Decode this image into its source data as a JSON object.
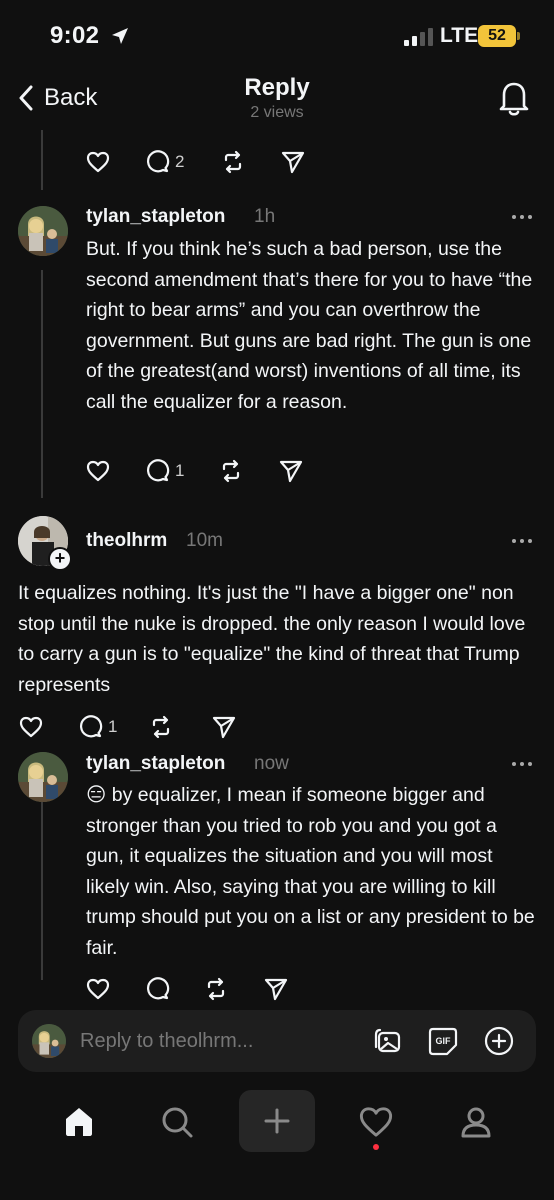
{
  "status_bar": {
    "time": "9:02",
    "network": "LTE",
    "battery": "52"
  },
  "header": {
    "back_label": "Back",
    "title": "Reply",
    "subtitle": "2 views"
  },
  "top_actions": {
    "replies": "2"
  },
  "posts": [
    {
      "username": "tylan_stapleton",
      "time": "1h",
      "text": "But. If you think he’s such a bad person, use the second amendment that’s there for you to have “the right to bear arms” and you can overthrow the government. But guns are bad right. The gun is one of the greatest(and worst) inventions of all time, its call the equalizer for a reason.",
      "replies": "1"
    },
    {
      "username": "theolhrm",
      "time": "10m",
      "text": "It equalizes nothing. It's just the \"I have a bigger one\" non stop until the nuke is dropped. the only reason I would love to carry a gun is to \"equalize\" the kind of threat that Trump represents",
      "replies": "1"
    },
    {
      "username": "tylan_stapleton",
      "time": "now",
      "emoji": "😑",
      "text": " by equalizer, I mean if someone bigger and stronger than you tried to rob you and you got a gun, it equalizes the situation and you will most likely win. Also, saying that you are willing to kill trump should put you on a list or any president to be fair.",
      "replies": ""
    }
  ],
  "reply_bar": {
    "placeholder": "Reply to theolhrm..."
  },
  "tab_bar": {
    "items": [
      "home-icon",
      "search-icon",
      "create-icon",
      "heart-icon",
      "profile-icon"
    ],
    "notification_color": "#ff3040"
  },
  "colors": {
    "background": "#101010",
    "text": "#f3f5f7",
    "muted": "#777777",
    "battery": "#f2c43a"
  }
}
